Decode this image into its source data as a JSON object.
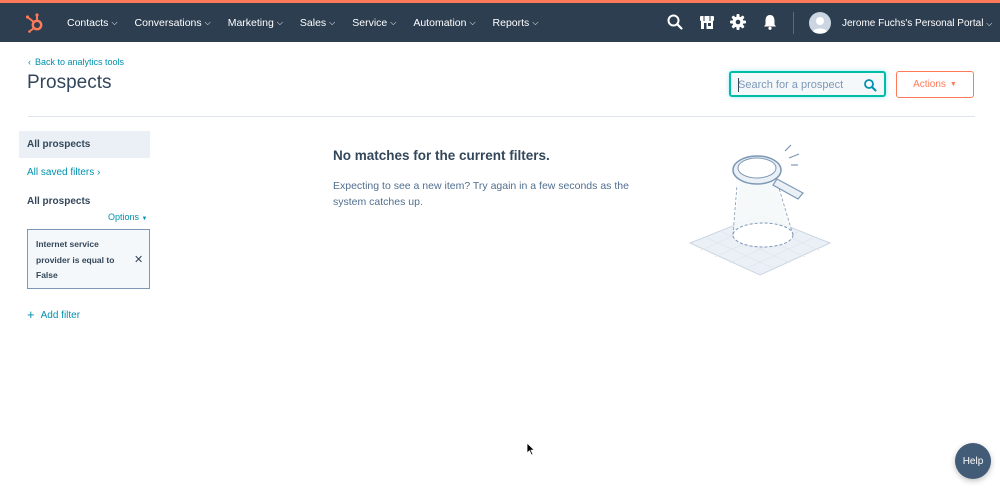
{
  "nav": {
    "items": [
      {
        "label": "Contacts"
      },
      {
        "label": "Conversations"
      },
      {
        "label": "Marketing"
      },
      {
        "label": "Sales"
      },
      {
        "label": "Service"
      },
      {
        "label": "Automation"
      },
      {
        "label": "Reports"
      }
    ],
    "portal_name": "Jerome Fuchs's Personal Portal",
    "icons": [
      "search-icon",
      "marketplace-icon",
      "settings-icon",
      "notifications-icon"
    ]
  },
  "header": {
    "back_link": "Back to analytics tools",
    "title": "Prospects",
    "search_placeholder": "Search for a prospect",
    "actions_label": "Actions"
  },
  "sidebar": {
    "all_prospects": "All prospects",
    "saved_filters": "All saved filters",
    "section_title": "All prospects",
    "options_label": "Options",
    "filter_text": "Internet service provider is equal to False",
    "add_filter": "Add filter"
  },
  "main": {
    "empty_title": "No matches for the current filters.",
    "empty_desc": "Expecting to see a new item? Try again in a few seconds as the system catches up."
  },
  "help_label": "Help",
  "colors": {
    "nav_bg": "#2d3e50",
    "accent_orange": "#ff7a59",
    "link": "#0091ae",
    "search_focus": "#00bda5"
  }
}
